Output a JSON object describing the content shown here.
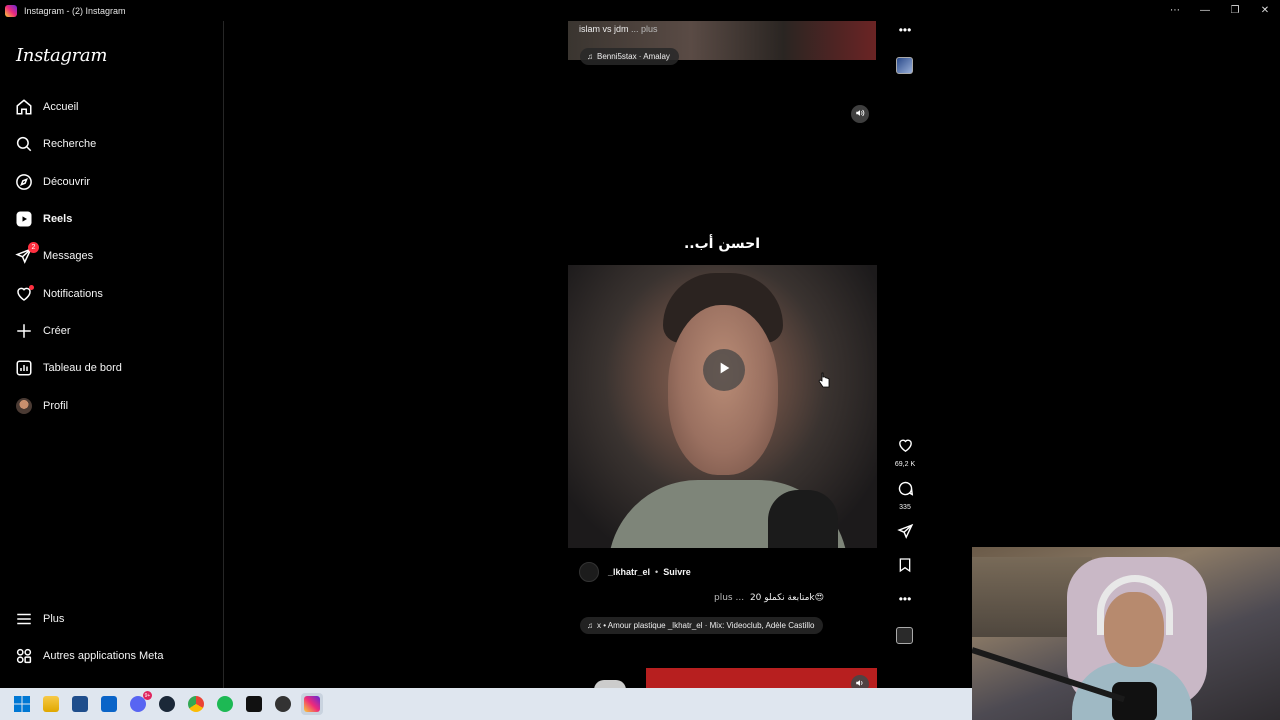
{
  "window": {
    "title": "Instagram - (2) Instagram",
    "controls": [
      "more-icon",
      "minimize-icon",
      "restore-icon",
      "close-icon"
    ]
  },
  "sidebar": {
    "logo": "Instagram",
    "items": [
      {
        "label": "Accueil",
        "icon": "home-icon"
      },
      {
        "label": "Recherche",
        "icon": "search-icon"
      },
      {
        "label": "Découvrir",
        "icon": "compass-icon"
      },
      {
        "label": "Reels",
        "icon": "reels-icon",
        "active": true
      },
      {
        "label": "Messages",
        "icon": "messenger-icon",
        "badge": "2"
      },
      {
        "label": "Notifications",
        "icon": "heart-icon",
        "dot": true
      },
      {
        "label": "Créer",
        "icon": "plus-icon"
      },
      {
        "label": "Tableau de bord",
        "icon": "dashboard-icon"
      },
      {
        "label": "Profil",
        "icon": "avatar"
      }
    ],
    "bottom": [
      {
        "label": "Plus",
        "icon": "menu-icon"
      },
      {
        "label": "Autres applications Meta",
        "icon": "meta-apps-icon"
      }
    ]
  },
  "reel_prev": {
    "caption": "islam vs jdm",
    "more": "... plus",
    "music": "Benni5stax · Amalay"
  },
  "reel": {
    "overlay_text": "احسن أب..",
    "author": "_lkhatr_el",
    "separator": "•",
    "follow": "Suivre",
    "caption": "متابعة نكملو 20k😍",
    "more": "plus ...",
    "music": "x • Amour plastique  _lkhatr_el · Mix: Videoclub, Adèle Castillo",
    "likes": "69,2 K",
    "comments": "335"
  },
  "colors": {
    "background": "#000000",
    "badge": "#ff3040",
    "taskbar": "#dfe6ef"
  },
  "taskbar": {
    "apps": [
      "windows-start-icon",
      "file-explorer-icon",
      "store-icon",
      "outlook-icon",
      "discord-icon",
      "steam-icon",
      "chrome-icon",
      "spotify-icon",
      "terminal-icon",
      "app-icon",
      "instagram-icon"
    ],
    "discord_badge": "9+"
  }
}
